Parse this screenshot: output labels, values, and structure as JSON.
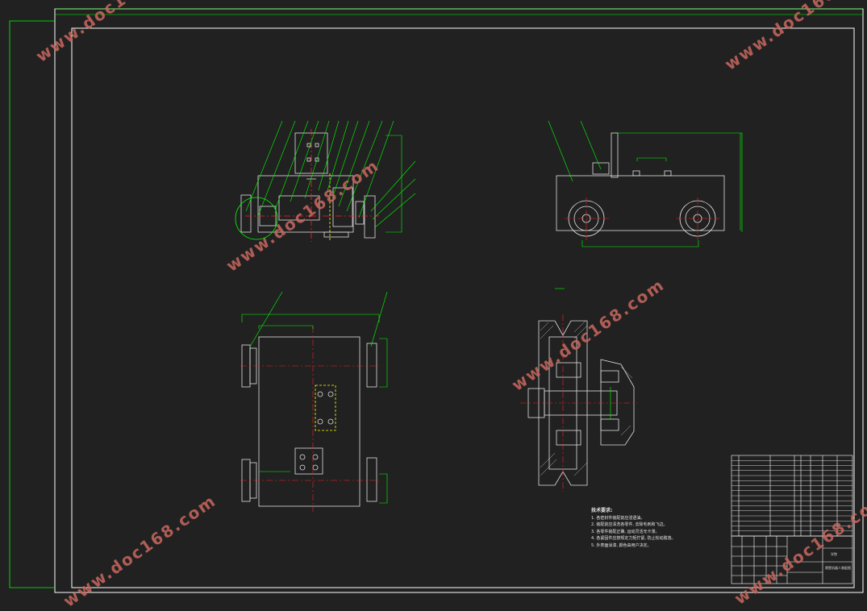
{
  "watermarks": [
    "www.doc168.com",
    "www.doc168.com",
    "www.doc168.com",
    "www.doc168.com",
    "www.doc168.com",
    "www.doc168.com"
  ],
  "technical_notes": {
    "title": "技术要求:",
    "lines": [
      "1. 各密封件装配前应浸透油。",
      "2. 装配前应清洗各零件, 去除毛刺和飞边。",
      "3. 各零件装配正确, 运动灵活无卡滞。",
      "4. 各紧固件应按规定力矩拧紧, 防止松动脱落。",
      "5. 外表面涂漆, 颜色由用户决定。"
    ]
  },
  "title_block": {
    "drawing_name": "爬壁机器人装配图",
    "company": "学院"
  },
  "colors": {
    "background": "#212121",
    "frame": "#ffffff",
    "dim": "#00ff00",
    "center": "#ff2020",
    "hidden": "#ffff00",
    "part": "#e0e0e0"
  }
}
